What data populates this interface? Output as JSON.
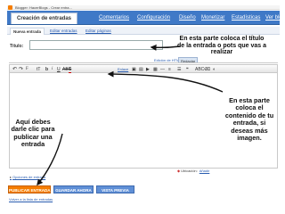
{
  "topbar": {
    "blog_name": "Blogger: HacerBlogs - Crear entra..."
  },
  "main_tabs": [
    {
      "label": "Creación de entradas",
      "active": true
    },
    {
      "label": "Comentarios",
      "active": false
    },
    {
      "label": "Configuración",
      "active": false
    },
    {
      "label": "Diseño",
      "active": false
    },
    {
      "label": "Monetizar",
      "active": false
    },
    {
      "label": "Estadísticas",
      "active": false
    },
    {
      "label": "Ver blog",
      "active": false
    }
  ],
  "sub_tabs": [
    {
      "label": "Nueva entrada",
      "active": true
    },
    {
      "label": "Editar entradas",
      "active": false
    },
    {
      "label": "Editar páginas",
      "active": false
    }
  ],
  "title_field": {
    "label": "Título:",
    "value": ""
  },
  "editor": {
    "tabs": {
      "html": "Edición de HTML",
      "compose": "Redactar"
    },
    "toolbar": {
      "undo": "↶",
      "redo": "↷",
      "font": "F",
      "size": "tT",
      "bold": "b",
      "italic": "i",
      "underline": "U",
      "strike": "ABC",
      "textcolor": "T",
      "link": "Enlace",
      "image": "▣",
      "image2": "▤",
      "video": "▶",
      "film": "▦",
      "break": "—",
      "align": "≡",
      "list": "☰",
      "quote": "❝",
      "spell": "ABC✓",
      "clean": "⌫",
      "more": "◐"
    }
  },
  "location": {
    "label": "Ubicación:",
    "change": "Añadir"
  },
  "entry_options": {
    "label": "Opciones de entrada"
  },
  "buttons": {
    "publish": "PUBLICAR ENTRADA",
    "save": "GUARDAR AHORA",
    "preview": "VISTA PREVIA"
  },
  "back_link": "Volver a la lista de entradas",
  "annotations": {
    "title_note": [
      "En esta parte coloca el título",
      "de la entrada o pots que vas a",
      "realizar"
    ],
    "content_note": [
      "En esta parte",
      "coloca el",
      "contenido de tu",
      "entrada, si",
      "deseas más",
      "imagen."
    ],
    "publish_note": [
      "Aquí debes",
      "darle clic para",
      "publicar  una",
      "entrada"
    ]
  },
  "colors": {
    "tab_blue": "#3f79c7",
    "publish_orange": "#f57d00",
    "secondary_blue": "#5f8fd6",
    "link_blue": "#2a5db0"
  }
}
